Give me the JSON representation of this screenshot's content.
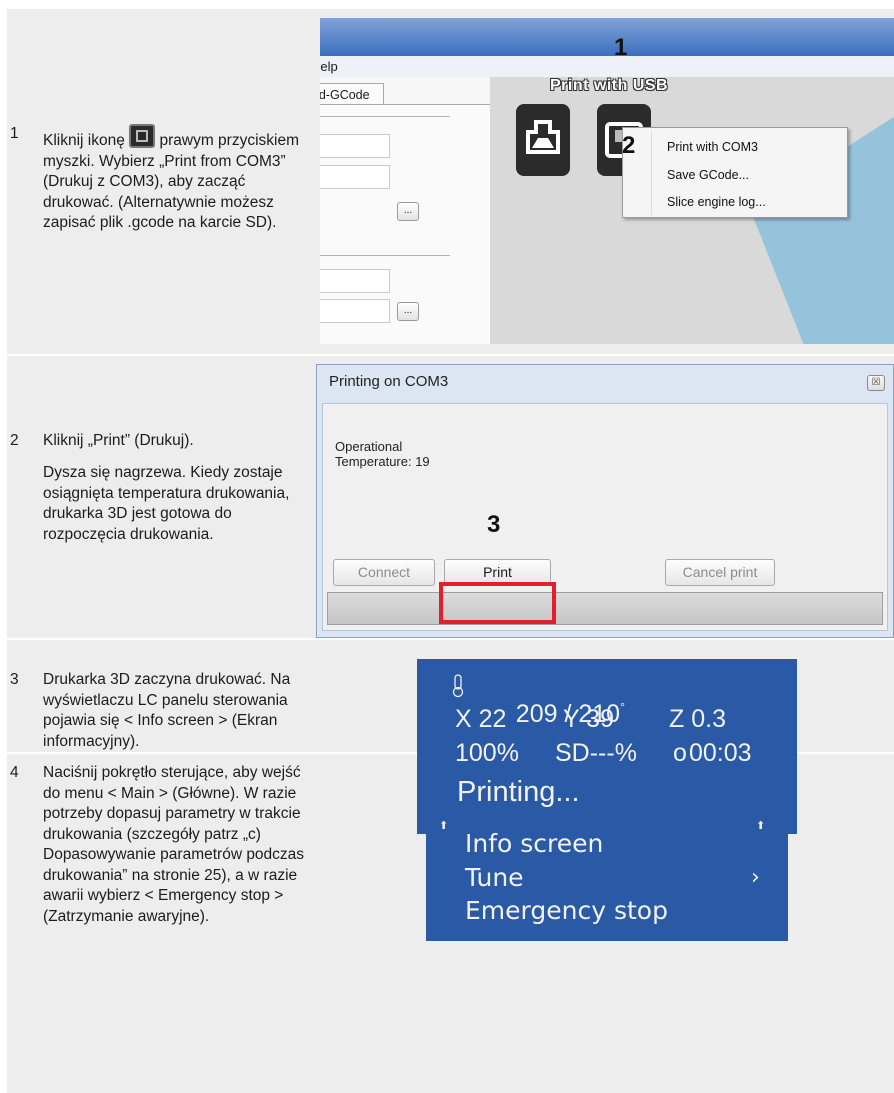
{
  "steps": {
    "s1": {
      "num": "1",
      "text_a": "Kliknij ikonę",
      "text_b": " prawym przyciskiem myszki. Wybierz „Print from COM3” (Drukuj z COM3), aby zacząć drukować. (Alternatywnie możesz zapisać plik .gcode na karcie SD)."
    },
    "s2": {
      "num": "2",
      "text": "Kliknij „Print” (Drukuj).",
      "text2": "Dysza się nagrzewa. Kiedy zostaje osiągnięta temperatura drukowania, drukarka 3D jest gotowa do rozpoczęcia drukowania."
    },
    "s3": {
      "num": "3",
      "text": "Drukarka 3D zaczyna drukować. Na wyświetlaczu LC panelu sterowania pojawia się < Info screen > (Ekran informacyjny)."
    },
    "s4": {
      "num": "4",
      "text": "Naciśnij pokrętło sterujące, aby wejść do menu < Main > (Główne). W razie potrzeby dopasuj parametry w trakcie drukowania (szczegóły patrz „c) Dopasowywanie parametrów podczas drukowania” na stronie 25), a w razie awarii wybierz < Emergency stop > (Zatrzymanie awaryjne)."
    }
  },
  "panel1": {
    "menu_text": "Help",
    "tab_label": "Load-GCode",
    "dots_label": "...",
    "print_usb_title": "Print with USB",
    "marker1": "1",
    "marker2": "2",
    "context_menu": [
      "Print with COM3",
      "Save GCode...",
      "Slice engine log..."
    ]
  },
  "panel2": {
    "title": "Printing on COM3",
    "close_label": "☒",
    "status_line1": "Operational",
    "status_line2": "Temperature: 19",
    "marker3": "3",
    "connect_label": "Connect",
    "print_label": "Print",
    "cancel_label": "Cancel print"
  },
  "lcd_info": {
    "temp_icon": "thermometer-icon",
    "temp": "209 / 210",
    "degree": "°",
    "x": "X 22",
    "y": "Y 39",
    "z": "Z 0.3",
    "speed": "100%",
    "sd": "SD---%",
    "clock_icon": "o",
    "time": "00:03",
    "status": "Printing..."
  },
  "lcd_menu": {
    "items": [
      "Info screen",
      "Tune",
      "Emergency stop"
    ],
    "submenu_arrow": "›",
    "up_arrow": "⬆"
  },
  "colors": {
    "lcd_background": "#2a5aa6",
    "highlight_frame": "#e0202a",
    "band_gray": "#ededed"
  }
}
